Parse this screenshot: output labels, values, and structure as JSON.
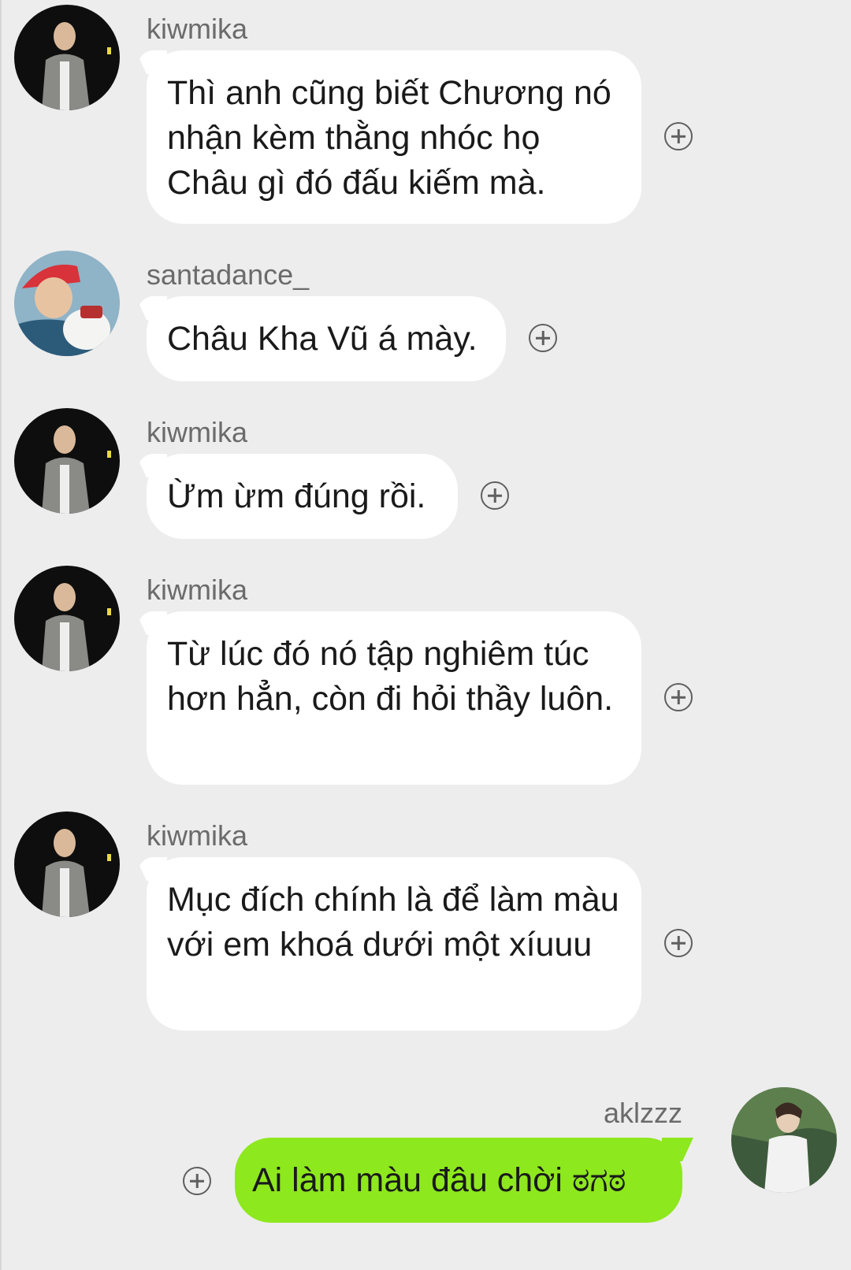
{
  "messages": [
    {
      "sender": "kiwmika",
      "text": "Thì anh cũng biết Chương nó nhận kèm thằng nhóc họ Châu gì đó đấu kiếm mà.",
      "avatar": "kiwmika-avatar"
    },
    {
      "sender": "santadance_",
      "text": "Châu Kha Vũ á mày.",
      "avatar": "santadance-avatar"
    },
    {
      "sender": "kiwmika",
      "text": "Ừm ừm đúng rồi.",
      "avatar": "kiwmika-avatar"
    },
    {
      "sender": "kiwmika",
      "text": "Từ lúc đó nó tập nghiêm túc hơn hẳn, còn đi hỏi thầy luôn.",
      "avatar": "kiwmika-avatar"
    },
    {
      "sender": "kiwmika",
      "text": "Mục đích chính là để làm màu với em khoá dưới một xíuuu",
      "avatar": "kiwmika-avatar"
    },
    {
      "sender": "aklzzz",
      "text": "Ai làm màu đâu chời ಠಗಠ",
      "avatar": "aklzzz-avatar",
      "outgoing": true
    }
  ],
  "icons": {
    "add_reaction": "plus-circle-icon"
  },
  "colors": {
    "background": "#ededed",
    "incoming_bubble": "#ffffff",
    "outgoing_bubble": "#8ee81e",
    "sender_text": "#6b6b6b"
  }
}
